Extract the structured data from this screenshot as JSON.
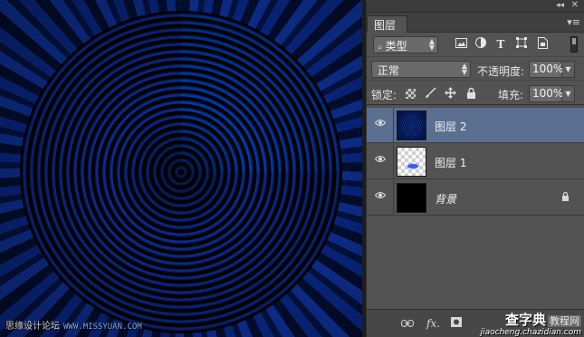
{
  "canvas": {
    "watermark_left_text": "思缘设计论坛",
    "watermark_left_brand": "WWW.MISSYUAN.COM"
  },
  "panel": {
    "collapse_glyph": "◂◂",
    "close_glyph": "✕",
    "tab_label": "图层",
    "menu_glyph": "▾≡",
    "filter": {
      "search_glyph": "⌕",
      "value": "类型",
      "icons": [
        "image-filter-icon",
        "adjustment-filter-icon",
        "type-filter-icon",
        "shape-filter-icon",
        "smart-object-filter-icon"
      ],
      "type_glyph": "T"
    },
    "blend_mode": "正常",
    "opacity_label": "不透明度:",
    "opacity_value": "100%",
    "lock_label": "锁定:",
    "fill_label": "填充:",
    "fill_value": "100%",
    "layers": [
      {
        "name": "图层 2",
        "selected": true,
        "visible": true,
        "thumb": "swirl"
      },
      {
        "name": "图层 1",
        "selected": false,
        "visible": true,
        "thumb": "checker"
      },
      {
        "name": "背景",
        "selected": false,
        "visible": true,
        "thumb": "black",
        "locked": true
      }
    ],
    "bottom": {
      "link_glyph": "⊖",
      "fx_label": "fx."
    }
  },
  "watermark_right": {
    "site": "查字典",
    "tutorial": "教程网",
    "url": "jiaocheng.chazidian.com"
  },
  "colors": {
    "panel_bg": "#535353",
    "selected_layer": "#5b6f91",
    "canvas_blue": "#0b2f99"
  }
}
